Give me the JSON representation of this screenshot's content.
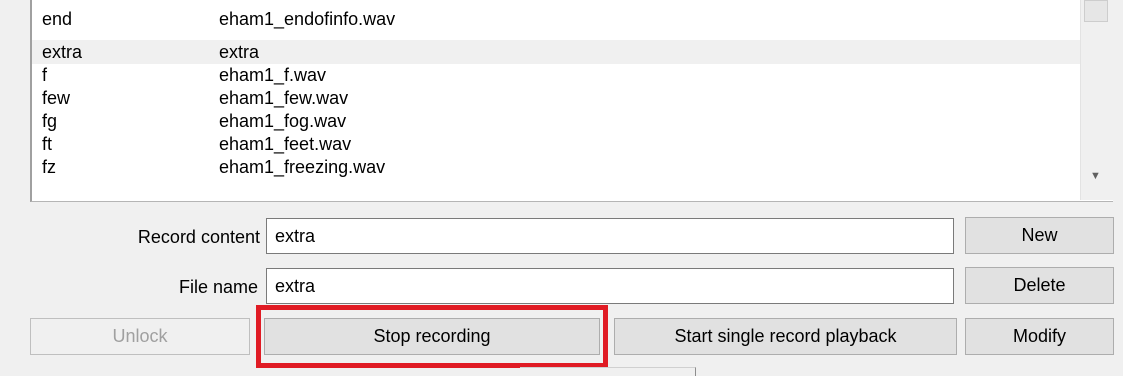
{
  "list": {
    "rows": [
      {
        "key": "end",
        "file": "eham1_endofinfo.wav"
      },
      {
        "key": "extra",
        "file": "extra"
      },
      {
        "key": "f",
        "file": "eham1_f.wav"
      },
      {
        "key": "few",
        "file": "eham1_few.wav"
      },
      {
        "key": "fg",
        "file": "eham1_fog.wav"
      },
      {
        "key": "ft",
        "file": "eham1_feet.wav"
      },
      {
        "key": "fz",
        "file": "eham1_freezing.wav"
      }
    ],
    "selected_index": 1
  },
  "form": {
    "record_content_label": "Record content",
    "record_content_value": "extra",
    "file_name_label": "File name",
    "file_name_value": "extra"
  },
  "buttons": {
    "new": "New",
    "delete": "Delete",
    "unlock": "Unlock",
    "stop_recording": "Stop recording",
    "start_playback": "Start single record playback",
    "modify": "Modify"
  },
  "colors": {
    "highlight": "#e01b24"
  }
}
